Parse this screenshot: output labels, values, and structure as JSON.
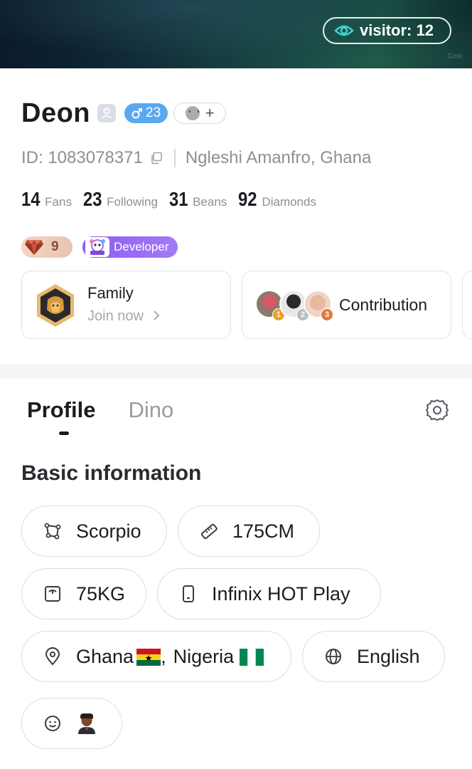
{
  "header": {
    "visitor_label": "visitor: 12",
    "watermark": "Gmli"
  },
  "profile": {
    "name": "Deon",
    "gender_age": "23",
    "add_symbol": "+",
    "id_text": "ID: 1083078371",
    "location": "Ngleshi Amanfro, Ghana"
  },
  "stats": [
    {
      "value": "14",
      "label": "Fans"
    },
    {
      "value": "23",
      "label": "Following"
    },
    {
      "value": "31",
      "label": "Beans"
    },
    {
      "value": "92",
      "label": "Diamonds"
    }
  ],
  "badges": {
    "level": "9",
    "developer": "Developer"
  },
  "cards": {
    "family_title": "Family",
    "family_sub": "Join now",
    "contribution_title": "Contribution",
    "ranks": [
      "1",
      "2",
      "3"
    ]
  },
  "tabs": [
    {
      "label": "Profile",
      "active": true
    },
    {
      "label": "Dino",
      "active": false
    }
  ],
  "basic_info": {
    "title": "Basic information",
    "zodiac": "Scorpio",
    "height": "175CM",
    "weight": "75KG",
    "device": "Infinix HOT Play",
    "country_1": "Ghana",
    "separator": ",",
    "country_2": "Nigeria",
    "language": "English"
  },
  "colors": {
    "accent_blue": "#5aa9f0",
    "developer_purple": "#8b5cf6",
    "rank_gold": "#f0a020",
    "rank_silver": "#b8bcc4",
    "rank_bronze": "#e07a3c"
  }
}
